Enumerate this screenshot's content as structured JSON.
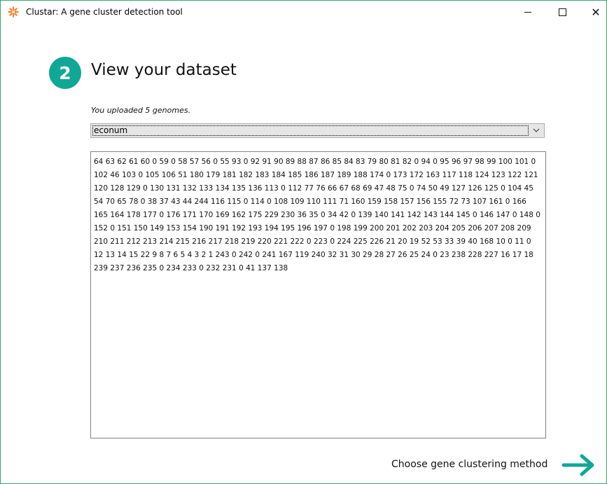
{
  "window": {
    "title": "Clustar: A gene cluster detection tool",
    "accent_color": "#10a796",
    "icons": {
      "app": "asterisk-logo-icon",
      "minimize": "minimize-icon",
      "maximize": "maximize-icon",
      "close": "close-icon"
    },
    "close_glyph": "✕"
  },
  "step": {
    "number": "2",
    "title": "View your dataset"
  },
  "upload_note": "You uploaded 5 genomes.",
  "genome_select": {
    "selected": "econum",
    "icon": "chevron-down-icon"
  },
  "dataset_text": "64 63 62 61 60 0 59 0 58 57 56 0 55 93 0 92 91 90 89 88 87 86 85 84 83 79 80 81 82 0 94 0 95 96 97 98 99 100 101 0 102 46 103 0 105 106 51 180 179 181 182 183 184 185 186 187 189 188 174 0 173 172 163 117 118 124 123 122 121 120 128 129 0 130 131 132 133 134 135 136 113 0 112 77 76 66 67 68 69 47 48 75 0 74 50 49 127 126 125 0 104 45 54 70 65 78 0 38 37 43 44 244 116 115 0 114 0 108 109 110 111 71 160 159 158 157 156 155 72 73 107 161 0 166 165 164 178 177 0 176 171 170 169 162 175 229 230 36 35 0 34 42 0 139 140 141 142 143 144 145 0 146 147 0 148 0 152 0 151 150 149 153 154 190 191 192 193 194 195 196 197 0 198 199 200 201 202 203 204 205 206 207 208 209 210 211 212 213 214 215 216 217 218 219 220 221 222 0 223 0 224 225 226 21 20 19 52 53 33 39 40 168 10 0 11 0 12 13 14 15 22 9 8 7 6 5 4 3 2 1 243 0 242 0 241 167 119 240 32 31 30 29 28 27 26 25 24 0 23 238 228 227 16 17 18 239 237 236 235 0 234 233 0 232 231 0 41 137 138",
  "next": {
    "label": "Choose gene clustering method",
    "icon": "arrow-right-icon",
    "color": "#10a796"
  }
}
